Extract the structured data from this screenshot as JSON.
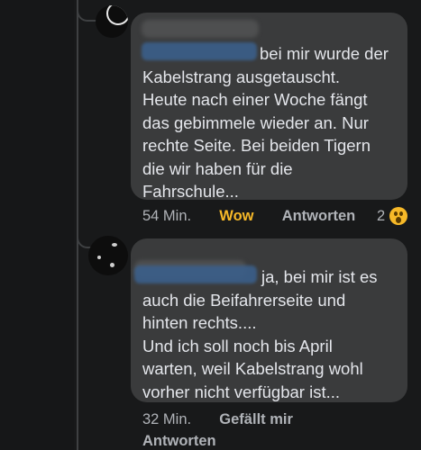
{
  "comments": [
    {
      "text": "bei mir wurde der\nKabelstrang ausgetauscht.\nHeute nach einer Woche fängt\ndas gebimmele wieder an. Nur\nrechte Seite. Bei beiden Tigern\ndie wir haben für die\nFahrschule...",
      "time": "54 Min.",
      "reaction_label": "Wow",
      "reply_label": "Antworten",
      "reaction_count": "2",
      "reaction_icon": "wow-emoji-icon"
    },
    {
      "text": "ja, bei mir ist es\nauch die Beifahrerseite und\nhinten rechts....\nUnd ich soll noch bis April\nwarten, weil Kabelstrang wohl\nvorher nicht verfügbar ist...",
      "time": "32 Min.",
      "like_label": "Gefällt mir",
      "reply_label": "Antworten"
    }
  ],
  "colors": {
    "background": "#18191a",
    "bubble": "#3a3b3c",
    "text": "#e4e6eb",
    "meta": "#b0b3b8",
    "wow": "#f7b928"
  }
}
